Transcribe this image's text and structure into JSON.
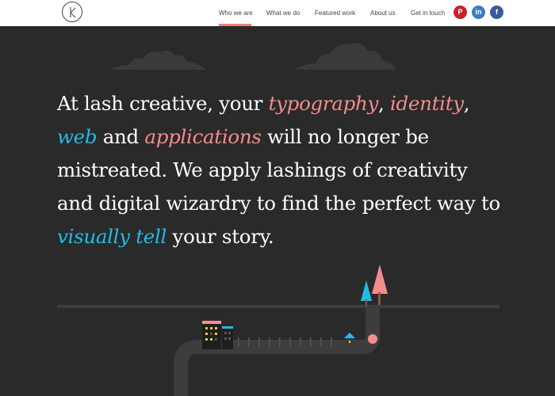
{
  "header": {
    "logo_letter": "K",
    "nav": [
      {
        "label": "Who we are",
        "active": true
      },
      {
        "label": "What we do",
        "active": false
      },
      {
        "label": "Featured work",
        "active": false
      },
      {
        "label": "About us",
        "active": false
      },
      {
        "label": "Get in touch",
        "active": false
      }
    ],
    "social": [
      {
        "icon": "pinterest-icon",
        "glyph": "P",
        "color": "#c92228"
      },
      {
        "icon": "linkedin-icon",
        "glyph": "in",
        "color": "#3b7dc4"
      },
      {
        "icon": "facebook-icon",
        "glyph": "f",
        "color": "#3b5a9a"
      }
    ]
  },
  "hero": {
    "t1": "At lash creative, your ",
    "h1": "typography",
    "t2": ", ",
    "h2": "identity",
    "t3": ",",
    "h3": "web",
    "t4": " and ",
    "h4": "applications",
    "t5": " will no longer be mistreated. We apply lashings of creativity and digital wizardry to find the perfect way to ",
    "h5": "visually tell",
    "t6": " your story."
  },
  "colors": {
    "background": "#2a2a2a",
    "accent_pink": "#f58c8c",
    "accent_blue": "#22bbe8",
    "header_bg": "#ffffff"
  }
}
